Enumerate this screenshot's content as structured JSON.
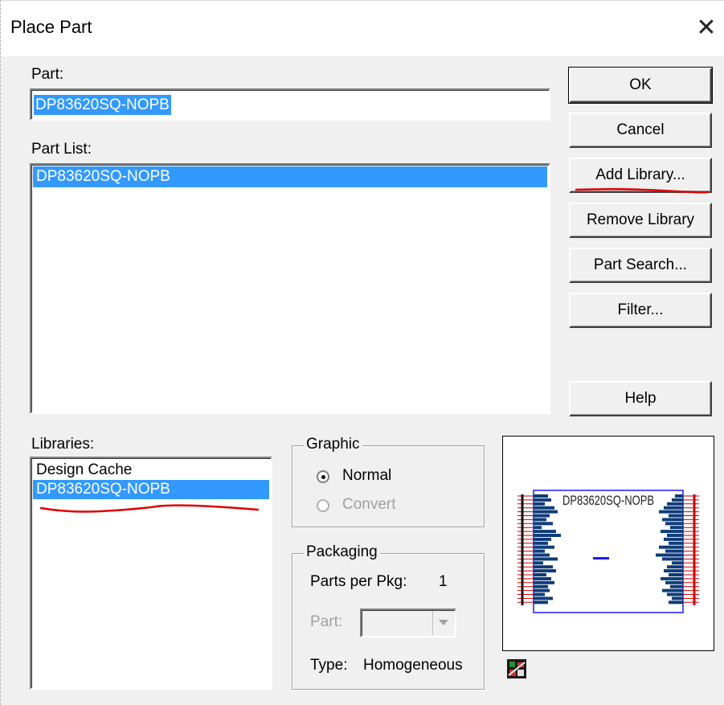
{
  "window": {
    "title": "Place Part",
    "close_glyph": "✕"
  },
  "part": {
    "label": "Part:",
    "value": "DP83620SQ-NOPB"
  },
  "part_list": {
    "label": "Part List:",
    "items": [
      "DP83620SQ-NOPB"
    ]
  },
  "libraries": {
    "label": "Libraries:",
    "items": [
      "Design Cache",
      "DP83620SQ-NOPB"
    ],
    "selected_index": 1
  },
  "buttons": {
    "ok": "OK",
    "cancel": "Cancel",
    "add_library": "Add Library...",
    "remove_library": "Remove Library",
    "part_search": "Part Search...",
    "filter": "Filter...",
    "help": "Help"
  },
  "graphic": {
    "title": "Graphic",
    "normal": "Normal",
    "convert": "Convert",
    "selected": "Normal"
  },
  "packaging": {
    "title": "Packaging",
    "parts_per_pkg_label": "Parts per Pkg:",
    "parts_per_pkg_value": "1",
    "part_label": "Part:",
    "type_label": "Type:",
    "type_value": "Homogeneous"
  },
  "preview": {
    "part_name": "DP83620SQ-NOPB"
  },
  "colors": {
    "selection": "#3399ff",
    "annotation_red": "#e00000",
    "symbol_outline": "#1a1aff",
    "pin_red": "#cc0000",
    "pin_bar_blue": "#0f3c78"
  },
  "icons": {
    "close": "close-icon",
    "dropdown": "chevron-down-icon",
    "package": "package-icon"
  }
}
